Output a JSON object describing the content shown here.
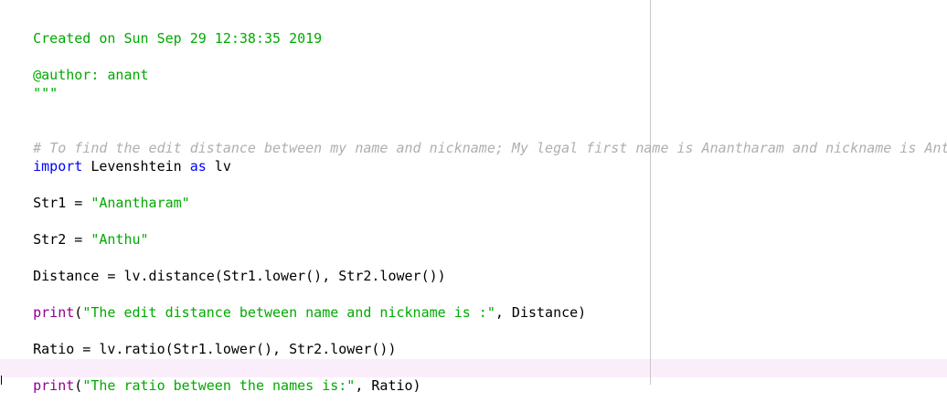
{
  "editor": {
    "lines": {
      "created": "Created on Sun Sep 29 12:38:35 2019",
      "author": "@author: anant",
      "docstring_close": "\"\"\"",
      "comment": "# To find the edit distance between my name and nickname; My legal first name is Anantharam and nickname is Anthu",
      "import_kw": "import",
      "import_module": " Levenshtein ",
      "import_as": "as",
      "import_alias": " lv",
      "str1_lhs": "Str1 = ",
      "str1_val": "\"Anantharam\"",
      "str2_lhs": "Str2 = ",
      "str2_val": "\"Anthu\"",
      "distance": "Distance = lv.distance(Str1.lower(), Str2.lower())",
      "print1_fn": "print",
      "print1_open": "(",
      "print1_str": "\"The edit distance between name and nickname is :\"",
      "print1_rest": ", Distance)",
      "ratio": "Ratio = lv.ratio(Str1.lower(), Str2.lower())",
      "print2_fn": "print",
      "print2_open": "(",
      "print2_str": "\"The ratio between the names is:\"",
      "print2_rest": ", Ratio)"
    },
    "colors": {
      "string": "#00aa00",
      "comment": "#afafaf",
      "keyword": "#0000ff",
      "builtin": "#900090",
      "current_line": "#fbeefb"
    }
  }
}
